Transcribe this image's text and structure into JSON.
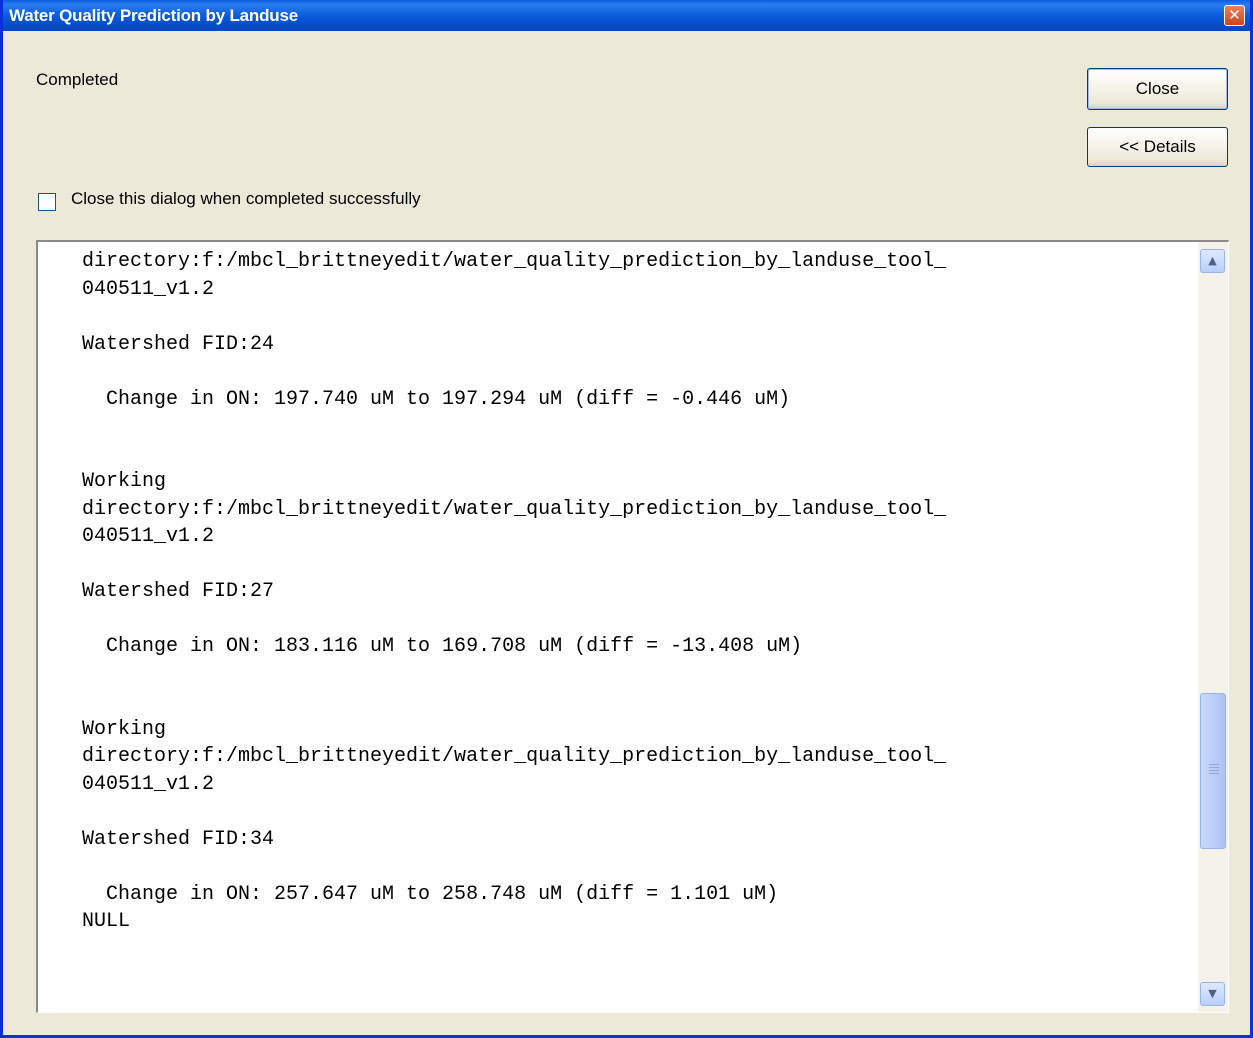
{
  "window": {
    "title": "Water Quality Prediction by Landuse"
  },
  "status": {
    "text": "Completed"
  },
  "buttons": {
    "close_label": "Close",
    "details_label": "<< Details"
  },
  "options": {
    "close_on_success_label": "Close this dialog when completed successfully",
    "close_on_success_checked": false
  },
  "log": {
    "lines": [
      "directory:f:/mbcl_brittneyedit/water_quality_prediction_by_landuse_tool_",
      "040511_v1.2",
      "",
      "Watershed FID:24",
      "",
      "  Change in ON: 197.740 uM to 197.294 uM (diff = -0.446 uM)",
      "",
      "",
      "Working",
      "directory:f:/mbcl_brittneyedit/water_quality_prediction_by_landuse_tool_",
      "040511_v1.2",
      "",
      "Watershed FID:27",
      "",
      "  Change in ON: 183.116 uM to 169.708 uM (diff = -13.408 uM)",
      "",
      "",
      "Working",
      "directory:f:/mbcl_brittneyedit/water_quality_prediction_by_landuse_tool_",
      "040511_v1.2",
      "",
      "Watershed FID:34",
      "",
      "  Change in ON: 257.647 uM to 258.748 uM (diff = 1.101 uM)",
      "NULL"
    ]
  }
}
